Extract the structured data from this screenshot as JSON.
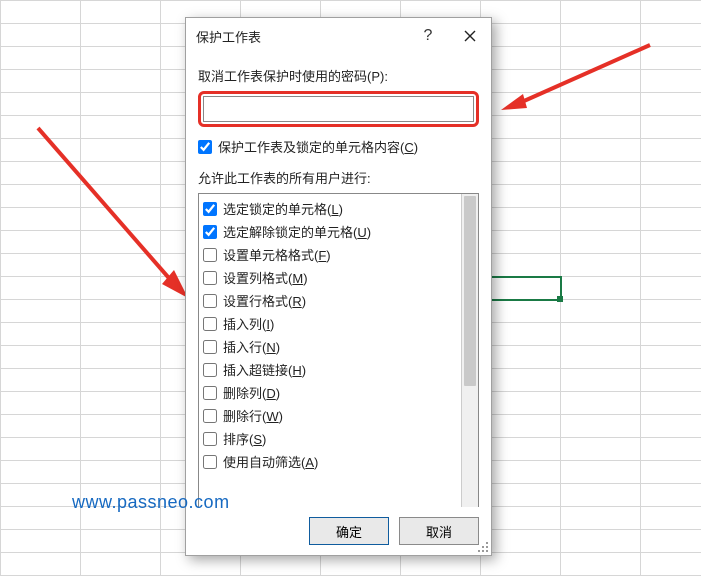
{
  "dialog": {
    "title": "保护工作表",
    "help_label": "?",
    "password_label": "取消工作表保护时使用的密码(P):",
    "password_value": "",
    "protect_checkbox": {
      "label": "保护工作表及锁定的单元格内容(",
      "accel": "C",
      "suffix": ")",
      "checked": true
    },
    "allow_label": "允许此工作表的所有用户进行:",
    "permissions": [
      {
        "label": "选定锁定的单元格(",
        "accel": "L",
        "suffix": ")",
        "checked": true
      },
      {
        "label": "选定解除锁定的单元格(",
        "accel": "U",
        "suffix": ")",
        "checked": true
      },
      {
        "label": "设置单元格格式(",
        "accel": "F",
        "suffix": ")",
        "checked": false
      },
      {
        "label": "设置列格式(",
        "accel": "M",
        "suffix": ")",
        "checked": false
      },
      {
        "label": "设置行格式(",
        "accel": "R",
        "suffix": ")",
        "checked": false
      },
      {
        "label": "插入列(",
        "accel": "I",
        "suffix": ")",
        "checked": false
      },
      {
        "label": "插入行(",
        "accel": "N",
        "suffix": ")",
        "checked": false
      },
      {
        "label": "插入超链接(",
        "accel": "H",
        "suffix": ")",
        "checked": false
      },
      {
        "label": "删除列(",
        "accel": "D",
        "suffix": ")",
        "checked": false
      },
      {
        "label": "删除行(",
        "accel": "W",
        "suffix": ")",
        "checked": false
      },
      {
        "label": "排序(",
        "accel": "S",
        "suffix": ")",
        "checked": false
      },
      {
        "label": "使用自动筛选(",
        "accel": "A",
        "suffix": ")",
        "checked": false
      }
    ],
    "ok_label": "确定",
    "cancel_label": "取消"
  },
  "watermark": "www.passneo.com"
}
